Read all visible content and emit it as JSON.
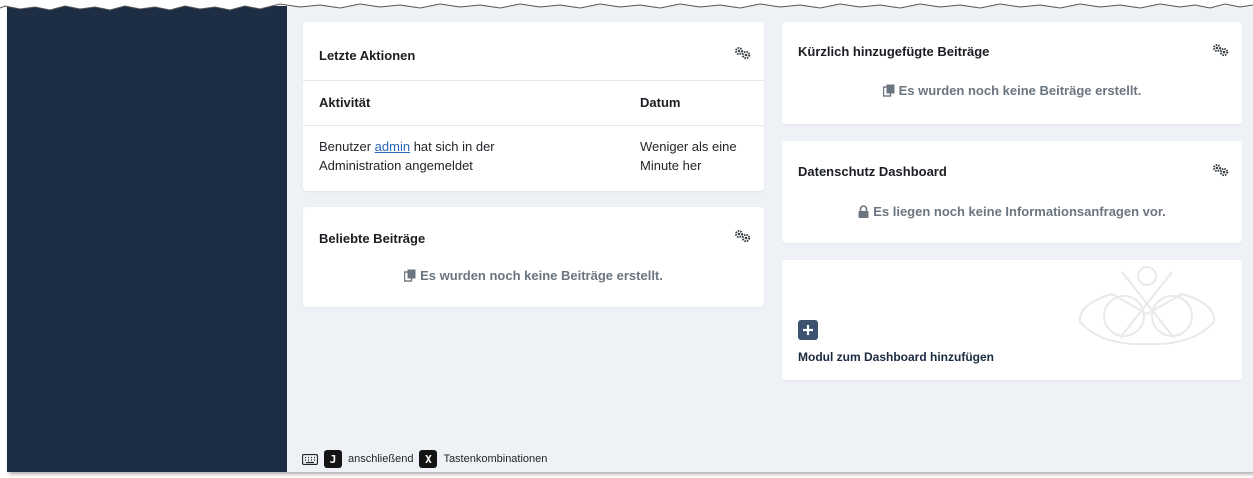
{
  "recent_actions": {
    "title": "Letzte Aktionen",
    "columns": [
      "Aktivität",
      "Datum"
    ],
    "rows": [
      {
        "activity_pre": "Benutzer ",
        "activity_user": "admin",
        "activity_mid": " hat sich in der",
        "activity_line2": "Administration angemeldet",
        "date_line1": "Weniger als eine",
        "date_line2": "Minute her"
      }
    ]
  },
  "popular_posts": {
    "title": "Beliebte Beiträge",
    "empty_message": "Es wurden noch keine Beiträge erstellt."
  },
  "recent_posts": {
    "title": "Kürzlich hinzugefügte Beiträge",
    "empty_message": "Es wurden noch keine Beiträge erstellt."
  },
  "privacy_dashboard": {
    "title": "Datenschutz Dashboard",
    "empty_message": "Es liegen noch keine Informationsanfragen vor."
  },
  "add_module": {
    "label": "Modul zum Dashboard hinzufügen"
  },
  "shortcuts": {
    "key1": "J",
    "then": "anschließend",
    "key2": "X",
    "label": "Tastenkombinationen"
  },
  "icons": {
    "options": "gears-icon",
    "empty_posts": "copy-icon",
    "privacy": "lock-icon",
    "add": "plus-icon",
    "keyboard": "keyboard-icon"
  },
  "colors": {
    "sidebar": "#1d2d44",
    "background": "#eef1f6",
    "link": "#2a69b8",
    "add_button": "#3d5170"
  }
}
